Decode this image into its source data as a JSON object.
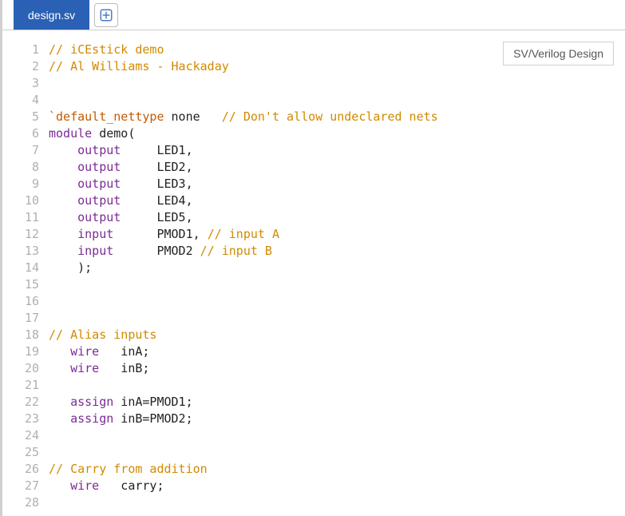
{
  "tabs": {
    "active": "design.sv"
  },
  "badge": "SV/Verilog Design",
  "gutter_start": 1,
  "gutter_end": 28,
  "code_lines": [
    [
      {
        "t": "// iCEstick demo",
        "c": "tok-comment"
      }
    ],
    [
      {
        "t": "// Al Williams - Hackaday",
        "c": "tok-comment"
      }
    ],
    [],
    [],
    [
      {
        "t": "`default_nettype",
        "c": "tok-directive"
      },
      {
        "t": " none   ",
        "c": ""
      },
      {
        "t": "// Don't allow undeclared nets",
        "c": "tok-comment"
      }
    ],
    [
      {
        "t": "module",
        "c": "tok-keyword"
      },
      {
        "t": " demo(",
        "c": ""
      }
    ],
    [
      {
        "t": "    ",
        "c": ""
      },
      {
        "t": "output",
        "c": "tok-keyword"
      },
      {
        "t": "     LED1,",
        "c": ""
      }
    ],
    [
      {
        "t": "    ",
        "c": ""
      },
      {
        "t": "output",
        "c": "tok-keyword"
      },
      {
        "t": "     LED2,",
        "c": ""
      }
    ],
    [
      {
        "t": "    ",
        "c": ""
      },
      {
        "t": "output",
        "c": "tok-keyword"
      },
      {
        "t": "     LED3,",
        "c": ""
      }
    ],
    [
      {
        "t": "    ",
        "c": ""
      },
      {
        "t": "output",
        "c": "tok-keyword"
      },
      {
        "t": "     LED4,",
        "c": ""
      }
    ],
    [
      {
        "t": "    ",
        "c": ""
      },
      {
        "t": "output",
        "c": "tok-keyword"
      },
      {
        "t": "     LED5,",
        "c": ""
      }
    ],
    [
      {
        "t": "    ",
        "c": ""
      },
      {
        "t": "input",
        "c": "tok-keyword"
      },
      {
        "t": "      PMOD1, ",
        "c": ""
      },
      {
        "t": "// input A",
        "c": "tok-comment"
      }
    ],
    [
      {
        "t": "    ",
        "c": ""
      },
      {
        "t": "input",
        "c": "tok-keyword"
      },
      {
        "t": "      PMOD2 ",
        "c": ""
      },
      {
        "t": "// input B",
        "c": "tok-comment"
      }
    ],
    [
      {
        "t": "    );",
        "c": ""
      }
    ],
    [],
    [],
    [],
    [
      {
        "t": "// Alias inputs",
        "c": "tok-comment"
      }
    ],
    [
      {
        "t": "   ",
        "c": ""
      },
      {
        "t": "wire",
        "c": "tok-keyword"
      },
      {
        "t": "   inA;",
        "c": ""
      }
    ],
    [
      {
        "t": "   ",
        "c": ""
      },
      {
        "t": "wire",
        "c": "tok-keyword"
      },
      {
        "t": "   inB;",
        "c": ""
      }
    ],
    [],
    [
      {
        "t": "   ",
        "c": ""
      },
      {
        "t": "assign",
        "c": "tok-keyword"
      },
      {
        "t": " inA=PMOD1;",
        "c": ""
      }
    ],
    [
      {
        "t": "   ",
        "c": ""
      },
      {
        "t": "assign",
        "c": "tok-keyword"
      },
      {
        "t": " inB=PMOD2;",
        "c": ""
      }
    ],
    [],
    [],
    [
      {
        "t": "// Carry from addition",
        "c": "tok-comment"
      }
    ],
    [
      {
        "t": "   ",
        "c": ""
      },
      {
        "t": "wire",
        "c": "tok-keyword"
      },
      {
        "t": "   carry;",
        "c": ""
      }
    ],
    []
  ]
}
